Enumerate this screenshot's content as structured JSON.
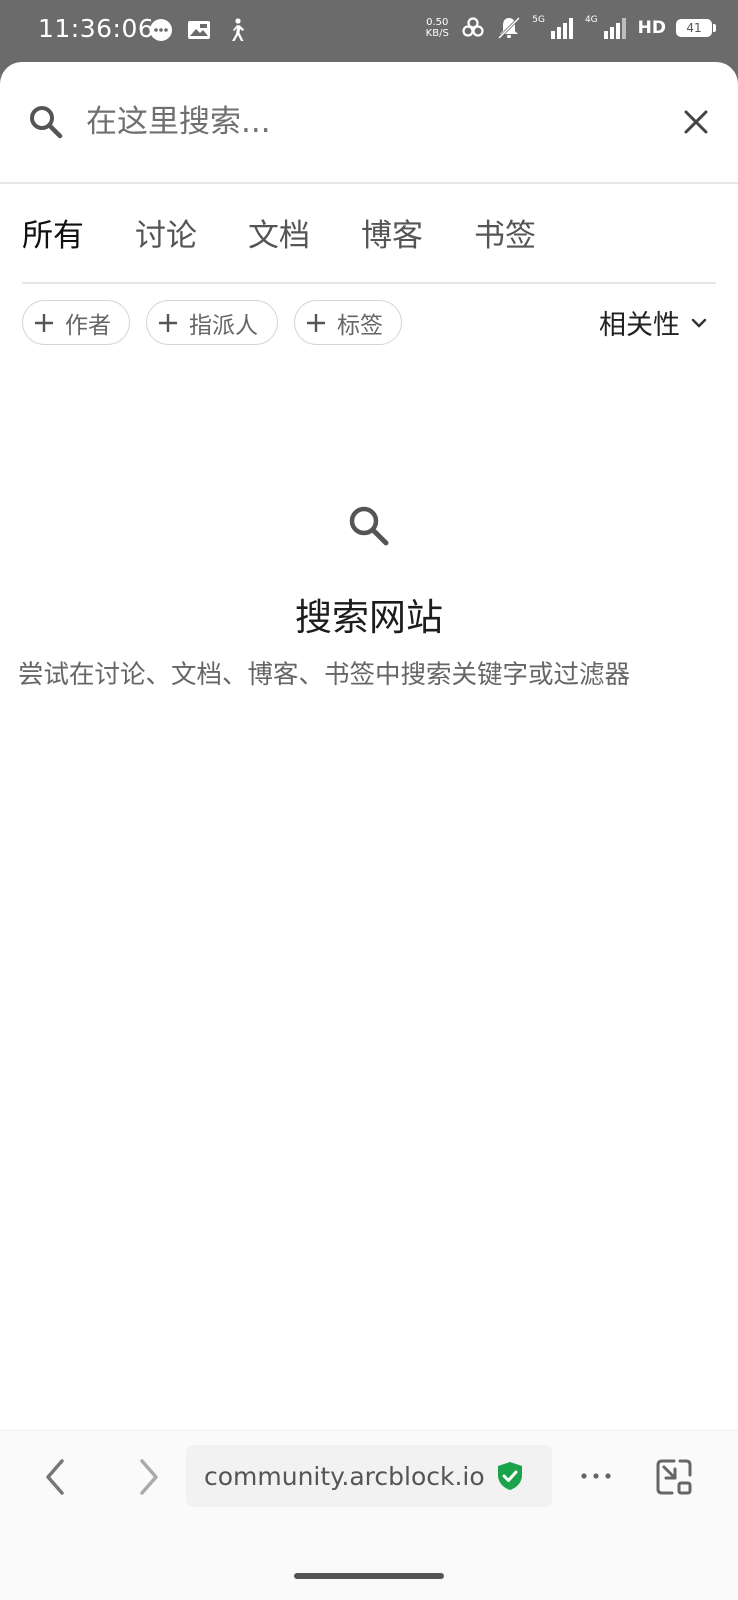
{
  "status_bar": {
    "time": "11:36:06",
    "net_speed_value": "0.50",
    "net_speed_unit": "KB/S",
    "signal1_label": "5G",
    "signal2_label": "4G",
    "hd_label": "HD",
    "battery_level": "41"
  },
  "search": {
    "placeholder": "在这里搜索...",
    "value": ""
  },
  "tabs": [
    {
      "label": "所有",
      "active": true
    },
    {
      "label": "讨论",
      "active": false
    },
    {
      "label": "文档",
      "active": false
    },
    {
      "label": "博客",
      "active": false
    },
    {
      "label": "书签",
      "active": false
    }
  ],
  "filters": {
    "chips": [
      "作者",
      "指派人",
      "标签"
    ],
    "sort_label": "相关性"
  },
  "empty_state": {
    "title": "搜索网站",
    "description": "尝试在讨论、文档、博客、书签中搜索关键字或过滤器"
  },
  "browser": {
    "url": "community.arcblock.io",
    "secure_color": "#1aa34a"
  },
  "colors": {
    "status_bar_bg": "#6b6b6b",
    "text_primary": "#111111",
    "text_secondary": "#666666",
    "divider": "#e6e6e6"
  }
}
